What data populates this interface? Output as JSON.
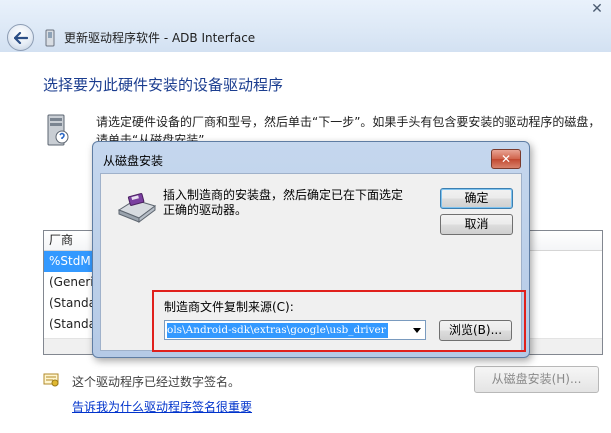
{
  "wizard": {
    "title": "更新驱动程序软件 - ADB Interface",
    "close_glyph": "✕",
    "heading": "选择要为此硬件安装的设备驱动程序",
    "instructions": "请选定硬件设备的厂商和型号，然后单击“下一步”。如果手头有包含要安装的驱动程序的磁盘，请单击“从磁盘安装”。",
    "manufacturer_header": "厂商",
    "manufacturers": [
      "%StdM",
      "(Generi",
      "(Standa",
      "(Standa"
    ],
    "signed_text": "这个驱动程序已经过数字签名。",
    "signing_link": "告诉我为什么驱动程序签名很重要",
    "have_disk_button": "从磁盘安装(H)..."
  },
  "dialog": {
    "title": "从磁盘安装",
    "close_glyph": "✕",
    "message": "插入制造商的安装盘，然后确定已在下面选定正确的驱动器。",
    "ok_button": "确定",
    "cancel_button": "取消",
    "copy_from_label": "制造商文件复制来源(C):",
    "copy_from_value": "ols\\Android-sdk\\extras\\google\\usb_driver",
    "browse_button": "浏览(B)..."
  },
  "colors": {
    "heading": "#1b3d8f",
    "selection": "#3399ff",
    "highlight_box": "#e0201c",
    "link": "#0033cc"
  },
  "icons": [
    "back-arrow-icon",
    "device-icon",
    "computer-icon",
    "disk-drive-icon",
    "signed-driver-icon",
    "chevron-down-icon",
    "close-icon"
  ]
}
